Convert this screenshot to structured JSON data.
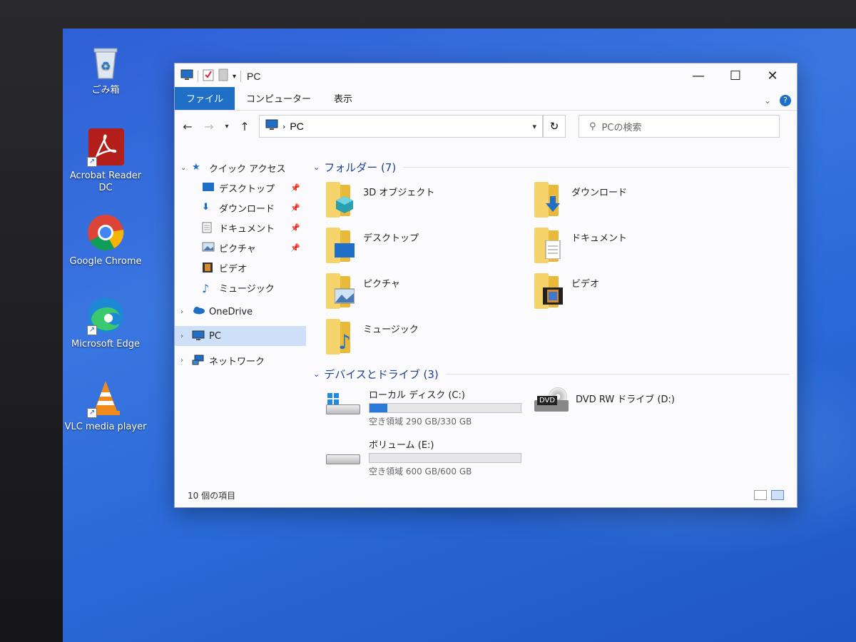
{
  "desktop_icons": [
    {
      "label": "ごみ箱",
      "icon": "recycle-bin-icon"
    },
    {
      "label": "Acrobat Reader DC",
      "icon": "acrobat-icon"
    },
    {
      "label": "Google Chrome",
      "icon": "chrome-icon"
    },
    {
      "label": "Microsoft Edge",
      "icon": "edge-icon"
    },
    {
      "label": "VLC media player",
      "icon": "vlc-icon"
    }
  ],
  "window": {
    "title": "PC",
    "minimize": "—",
    "maximize": "☐",
    "close": "✕"
  },
  "ribbon": {
    "tabs": [
      "ファイル",
      "コンピューター",
      "表示"
    ],
    "help": "?"
  },
  "navbar": {
    "address": "PC",
    "search_placeholder": "PCの検索"
  },
  "sidebar": {
    "quick_access": "クイック アクセス",
    "quick_items": [
      "デスクトップ",
      "ダウンロード",
      "ドキュメント",
      "ピクチャ",
      "ビデオ",
      "ミュージック"
    ],
    "onedrive": "OneDrive",
    "pc": "PC",
    "network": "ネットワーク"
  },
  "folders_group": "フォルダー (7)",
  "folders": [
    "3D オブジェクト",
    "ダウンロード",
    "デスクトップ",
    "ドキュメント",
    "ピクチャ",
    "ビデオ",
    "ミュージック"
  ],
  "drives_group": "デバイスとドライブ (3)",
  "drives": [
    {
      "name": "ローカル ディスク (C:)",
      "free": "空き領域 290 GB/330 GB",
      "used_fraction": 0.12
    },
    {
      "name": "DVD RW ドライブ (D:)"
    },
    {
      "name": "ボリューム (E:)",
      "free": "空き領域 600 GB/600 GB",
      "used_fraction": 0.0
    }
  ],
  "dvd_label": "DVD",
  "status": "10 個の項目",
  "colors": {
    "accent": "#1f6fc6",
    "desktop": "#2f6ad8",
    "folder": "#f6d46b"
  }
}
